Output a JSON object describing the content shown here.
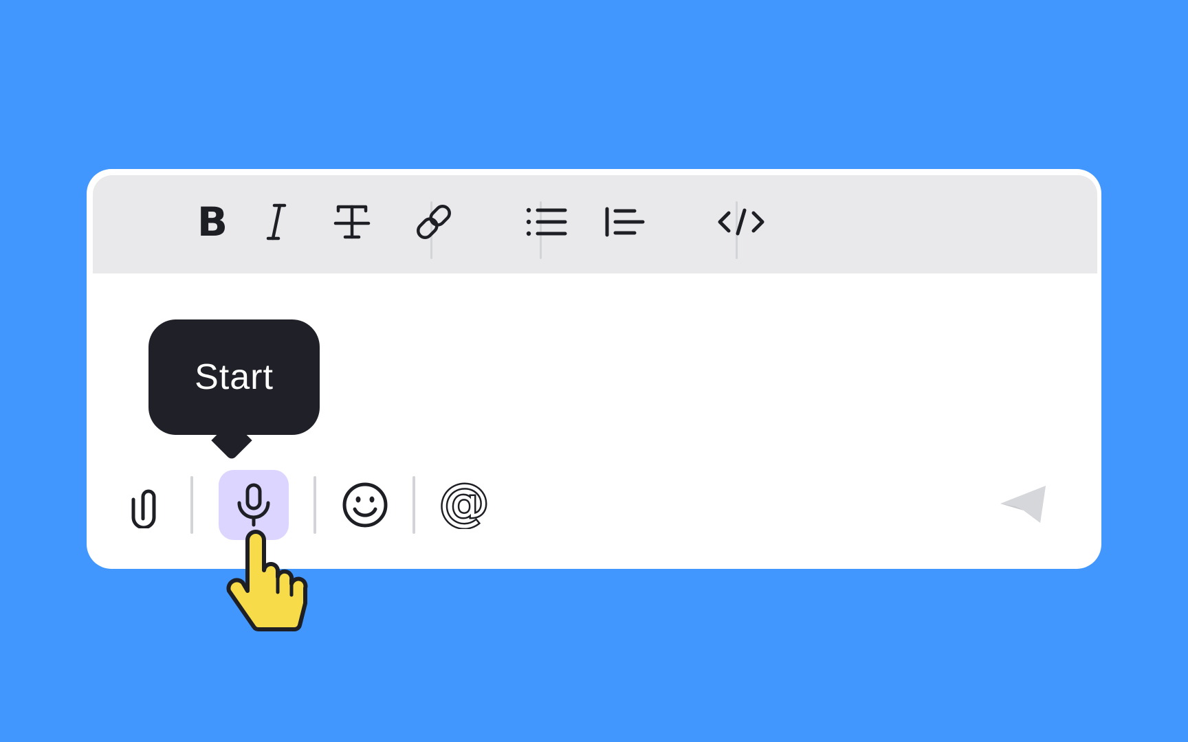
{
  "toolbar": {
    "buttons": [
      {
        "name": "bold",
        "icon": "bold-icon"
      },
      {
        "name": "italic",
        "icon": "italic-icon"
      },
      {
        "name": "strikethrough",
        "icon": "strikethrough-icon"
      },
      {
        "name": "link",
        "icon": "link-icon"
      },
      {
        "name": "bulleted-list",
        "icon": "bulleted-list-icon"
      },
      {
        "name": "block-quote",
        "icon": "block-quote-icon"
      },
      {
        "name": "code",
        "icon": "code-icon"
      }
    ]
  },
  "composer": {
    "actions": [
      {
        "name": "attach",
        "icon": "paperclip-icon"
      },
      {
        "name": "voice",
        "icon": "microphone-icon",
        "active": true
      },
      {
        "name": "emoji",
        "icon": "smiley-icon"
      },
      {
        "name": "mention",
        "icon": "at-sign-icon"
      },
      {
        "name": "send",
        "icon": "send-icon",
        "disabled": true
      }
    ],
    "tooltip": {
      "label": "Start"
    }
  },
  "colors": {
    "background": "#4197fd",
    "toolbar": "#e9e9eb",
    "icon": "#1e1f24",
    "tooltip": "#202128",
    "mic_active": "#dcd5ff",
    "send_disabled": "#d6d7da",
    "cursor_fill": "#f7db48"
  }
}
